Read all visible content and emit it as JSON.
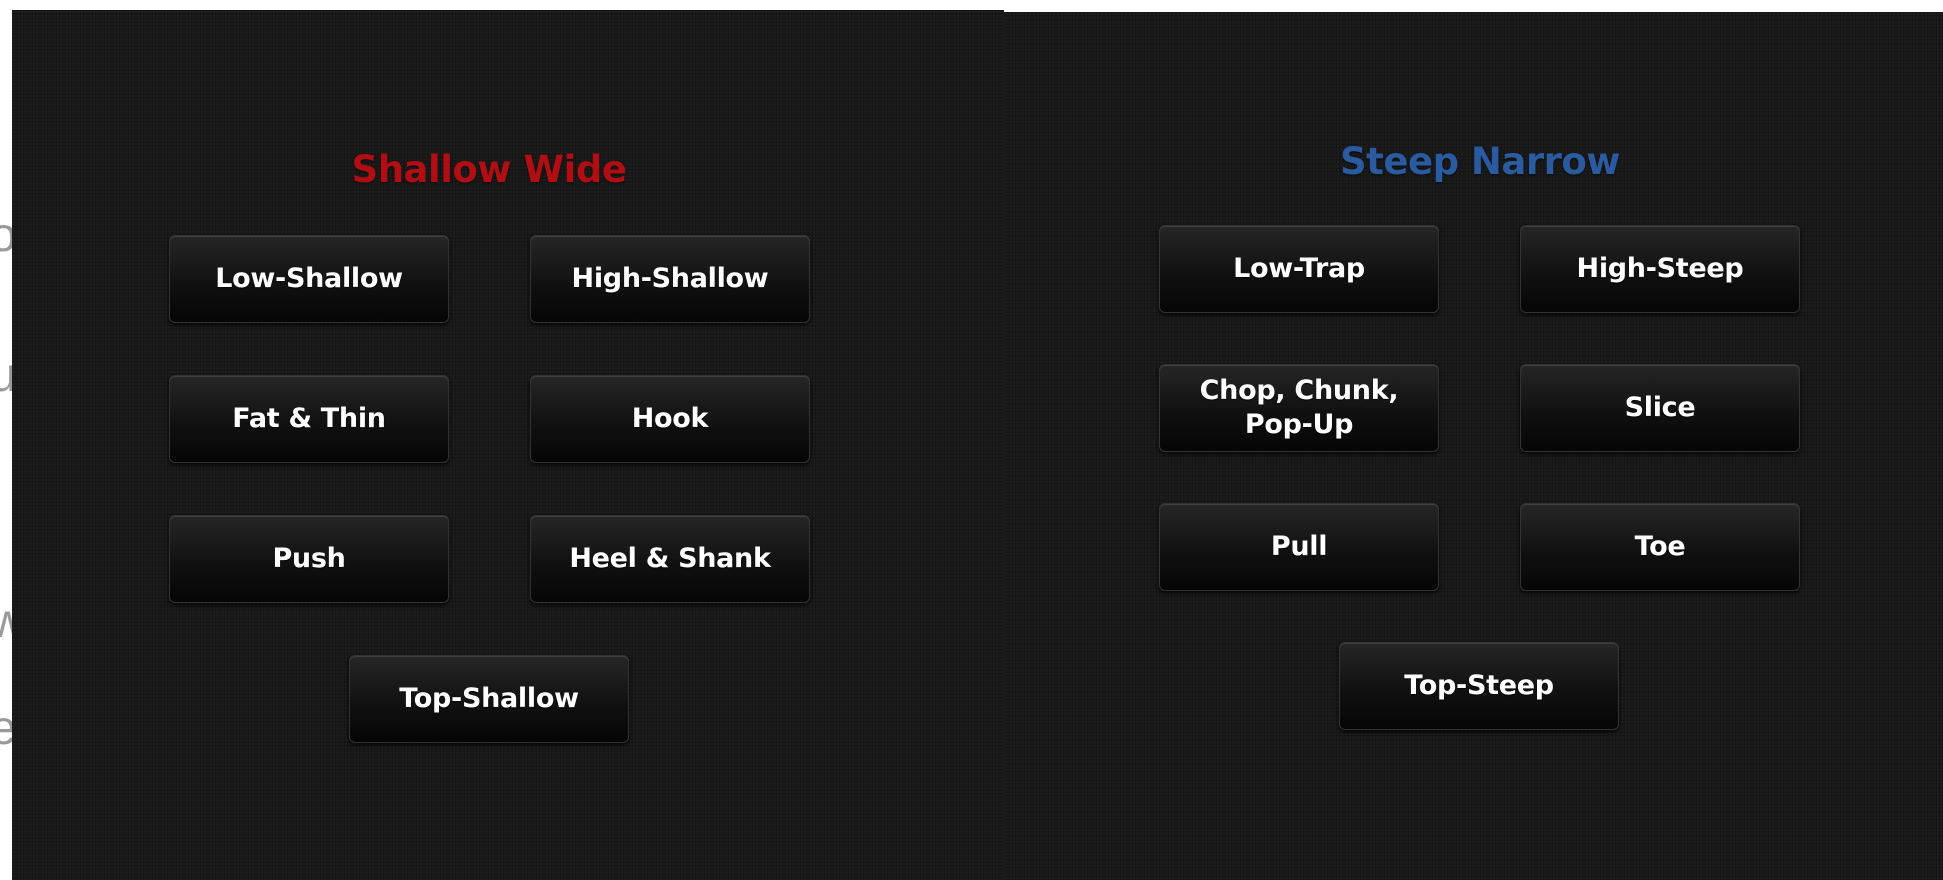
{
  "edge_fragments": [
    "o",
    "u",
    "w",
    "e"
  ],
  "sections": {
    "shallow_wide": {
      "title": "Shallow Wide",
      "title_color": "#b00e12",
      "buttons": [
        "Low-Shallow",
        "High-Shallow",
        "Fat & Thin",
        "Hook",
        "Push",
        "Heel & Shank",
        "Top-Shallow"
      ]
    },
    "steep_narrow": {
      "title": "Steep Narrow",
      "title_color": "#2a5aa0",
      "buttons": [
        "Low-Trap",
        "High-Steep",
        "Chop, Chunk,\nPop-Up",
        "Slice",
        "Pull",
        "Toe",
        "Top-Steep"
      ]
    }
  },
  "colors": {
    "panel_background": "#1a1a1a",
    "button_text": "#ffffff"
  }
}
